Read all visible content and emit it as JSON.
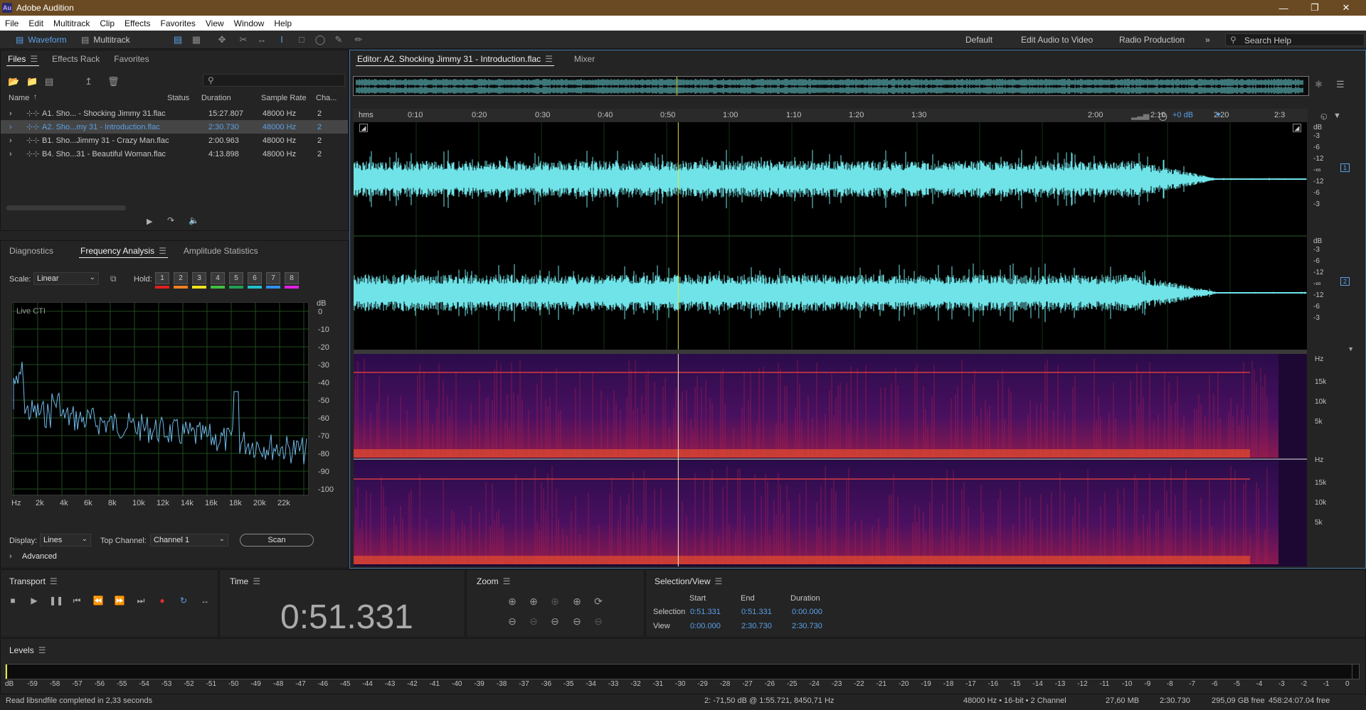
{
  "window": {
    "title": "Adobe Audition",
    "logo": "Au",
    "controls": [
      "minimize-icon",
      "maximize-icon",
      "close-icon"
    ]
  },
  "menu": [
    "File",
    "Edit",
    "Multitrack",
    "Clip",
    "Effects",
    "Favorites",
    "View",
    "Window",
    "Help"
  ],
  "toolbar": {
    "waveform_label": "Waveform",
    "multitrack_label": "Multitrack",
    "workspaces": [
      "Default",
      "Edit Audio to Video",
      "Radio Production"
    ],
    "more": "»",
    "search_placeholder": "Search Help"
  },
  "files_panel": {
    "tabs": [
      "Files",
      "Effects Rack",
      "Favorites"
    ],
    "columns": [
      "Name",
      "Status",
      "Duration",
      "Sample Rate",
      "Cha..."
    ],
    "rows": [
      {
        "name": "A1. Sho... - Shocking Jimmy 31.flac",
        "status": "",
        "duration": "15:27.807",
        "rate": "48000 Hz",
        "ch": "2"
      },
      {
        "name": "A2. Sho...my 31 - Introduction.flac",
        "status": "",
        "duration": "2:30.730",
        "rate": "48000 Hz",
        "ch": "2"
      },
      {
        "name": "B1. Sho...Jimmy 31 - Crazy Man.flac",
        "status": "",
        "duration": "2:00.963",
        "rate": "48000 Hz",
        "ch": "2"
      },
      {
        "name": "B4. Sho...31 - Beautiful Woman.flac",
        "status": "",
        "duration": "4:13.898",
        "rate": "48000 Hz",
        "ch": "2"
      }
    ],
    "selected_row": 1
  },
  "analysis_panel": {
    "tabs": [
      "Diagnostics",
      "Frequency Analysis",
      "Amplitude Statistics"
    ],
    "scale_label": "Scale:",
    "scale_value": "Linear",
    "hold_label": "Hold:",
    "hold_buttons": [
      "1",
      "2",
      "3",
      "4",
      "5",
      "6",
      "7",
      "8"
    ],
    "hold_colors": [
      "#e02020",
      "#f08020",
      "#f0e020",
      "#40c040",
      "#20a050",
      "#20c0d0",
      "#3090f0",
      "#e020e0"
    ],
    "graph_label": "Live CTI",
    "y_unit": "dB",
    "y_ticks": [
      "0",
      "-10",
      "-20",
      "-30",
      "-40",
      "-50",
      "-60",
      "-70",
      "-80",
      "-90",
      "-100"
    ],
    "x_ticks": [
      "Hz",
      "2k",
      "4k",
      "6k",
      "8k",
      "10k",
      "12k",
      "14k",
      "16k",
      "18k",
      "20k",
      "22k"
    ],
    "display_label": "Display:",
    "display_value": "Lines",
    "top_channel_label": "Top Channel:",
    "top_channel_value": "Channel 1",
    "scan_label": "Scan",
    "advanced_label": "Advanced"
  },
  "editor": {
    "tab_label": "Editor: A2. Shocking Jimmy 31 - Introduction.flac",
    "mixer_label": "Mixer",
    "ruler_unit": "hms",
    "ruler_ticks": [
      "0:10",
      "0:20",
      "0:30",
      "0:40",
      "0:50",
      "1:00",
      "1:10",
      "1:20",
      "1:30",
      "2:00",
      "2:10",
      "2:20",
      "2:3"
    ],
    "hud_gain": "+0 dB",
    "channel_badges": [
      "1",
      "2"
    ],
    "db_scale": [
      "dB",
      "-3",
      "-6",
      "-12",
      "-∞",
      "-12",
      "-6",
      "-3"
    ],
    "hz_scale": [
      "Hz",
      "15k",
      "10k",
      "5k"
    ],
    "waveform_color": "#6fe3e8",
    "playhead_color": "#e6e639",
    "playhead_seconds": 51.331,
    "duration_seconds": 150.73
  },
  "transport": {
    "title": "Transport"
  },
  "time_panel": {
    "title": "Time",
    "value": "0:51.331"
  },
  "zoom_panel": {
    "title": "Zoom"
  },
  "selection_panel": {
    "title": "Selection/View",
    "headers": [
      "Start",
      "End",
      "Duration"
    ],
    "rows": [
      {
        "label": "Selection",
        "start": "0:51.331",
        "end": "0:51.331",
        "duration": "0:00.000"
      },
      {
        "label": "View",
        "start": "0:00.000",
        "end": "2:30.730",
        "duration": "2:30.730"
      }
    ]
  },
  "levels": {
    "title": "Levels",
    "ticks": [
      "dB",
      "-59",
      "-58",
      "-57",
      "-56",
      "-55",
      "-54",
      "-53",
      "-52",
      "-51",
      "-50",
      "-49",
      "-48",
      "-47",
      "-46",
      "-45",
      "-44",
      "-43",
      "-42",
      "-41",
      "-40",
      "-39",
      "-38",
      "-37",
      "-36",
      "-35",
      "-34",
      "-33",
      "-32",
      "-31",
      "-30",
      "-29",
      "-28",
      "-27",
      "-26",
      "-25",
      "-24",
      "-23",
      "-22",
      "-21",
      "-20",
      "-19",
      "-18",
      "-17",
      "-16",
      "-15",
      "-14",
      "-13",
      "-12",
      "-11",
      "-10",
      "-9",
      "-8",
      "-7",
      "-6",
      "-5",
      "-4",
      "-3",
      "-2",
      "-1",
      "0"
    ]
  },
  "status": {
    "message": "Read libsndfile completed in 2,33 seconds",
    "cursor": "2: -71,50 dB @ 1:55.721, 8450,71 Hz",
    "format": "48000 Hz • 16-bit • 2 Channel",
    "size": "27,60 MB",
    "duration": "2:30.730",
    "free": "295,09 GB free",
    "free_time": "458:24:07.04 free"
  },
  "colors": {
    "accent": "#5aa0e8",
    "titlebar": "#6a4a22",
    "panel_bg": "#242424"
  }
}
